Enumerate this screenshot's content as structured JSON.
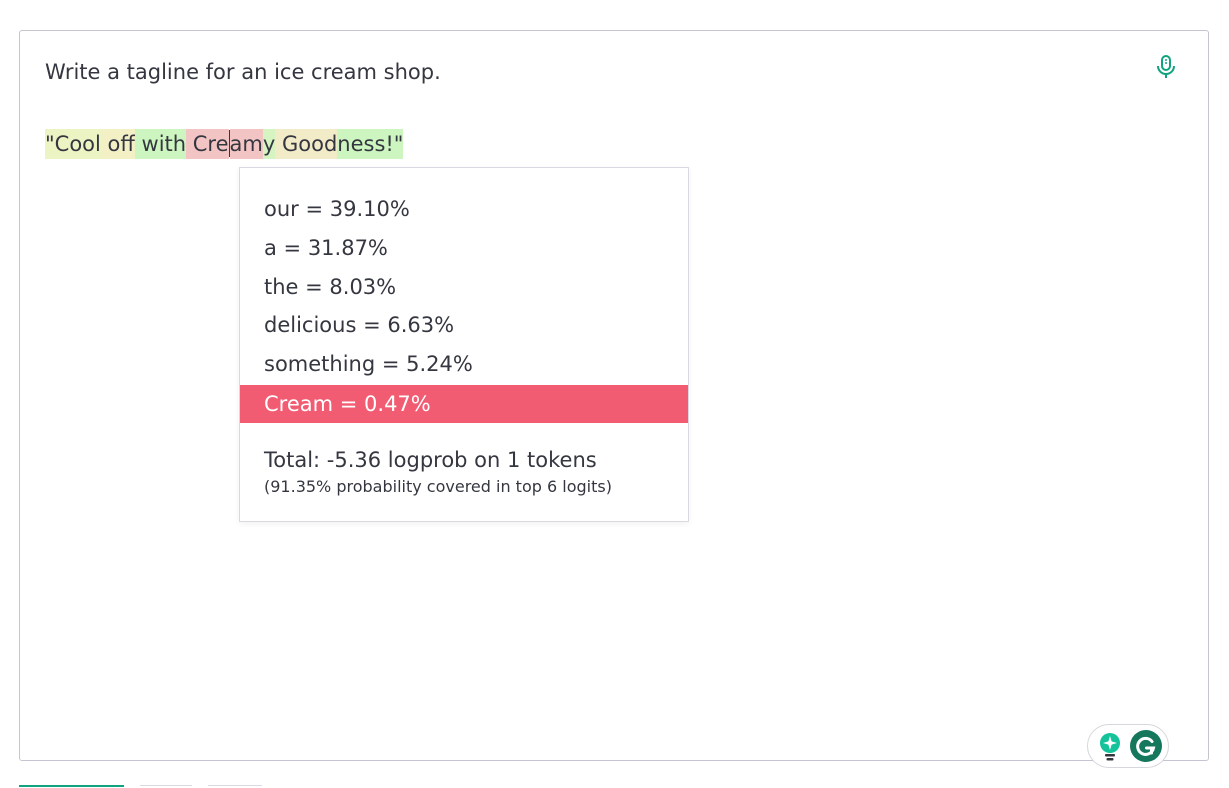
{
  "prompt": {
    "text": "Write a tagline for an ice cream shop."
  },
  "completion": {
    "tokens": [
      {
        "text": "\"Cool",
        "color": "#ecf4c4"
      },
      {
        "text": " off",
        "color": "#f4f0c6"
      },
      {
        "text": " with",
        "color": "#cdf5c0"
      },
      {
        "text": " Cre",
        "color": "#f3c4c4"
      },
      {
        "text": "am",
        "color": "#f3c4c4"
      },
      {
        "text": "y",
        "color": "#d6f4c2"
      },
      {
        "text": " Good",
        "color": "#f2ebc8"
      },
      {
        "text": "ness!\"",
        "color": "#cdf5c0"
      }
    ]
  },
  "popup": {
    "options": [
      {
        "label": "our = 39.10%",
        "selected": false
      },
      {
        "label": "a = 31.87%",
        "selected": false
      },
      {
        "label": "the = 8.03%",
        "selected": false
      },
      {
        "label": "delicious = 6.63%",
        "selected": false
      },
      {
        "label": "something = 5.24%",
        "selected": false
      },
      {
        "label": "Cream = 0.47%",
        "selected": true
      }
    ],
    "total": "Total: -5.36 logprob on 1 tokens",
    "coverage": "(91.35% probability covered in top 6 logits)"
  },
  "icons": {
    "microphone": "microphone-icon",
    "grammarly_suggestion": "lightbulb-icon",
    "grammarly_logo": "grammarly-logo-icon"
  },
  "colors": {
    "accent": "#10a37f",
    "selected_option": "#f25c73",
    "grammarly": "#15775c"
  }
}
